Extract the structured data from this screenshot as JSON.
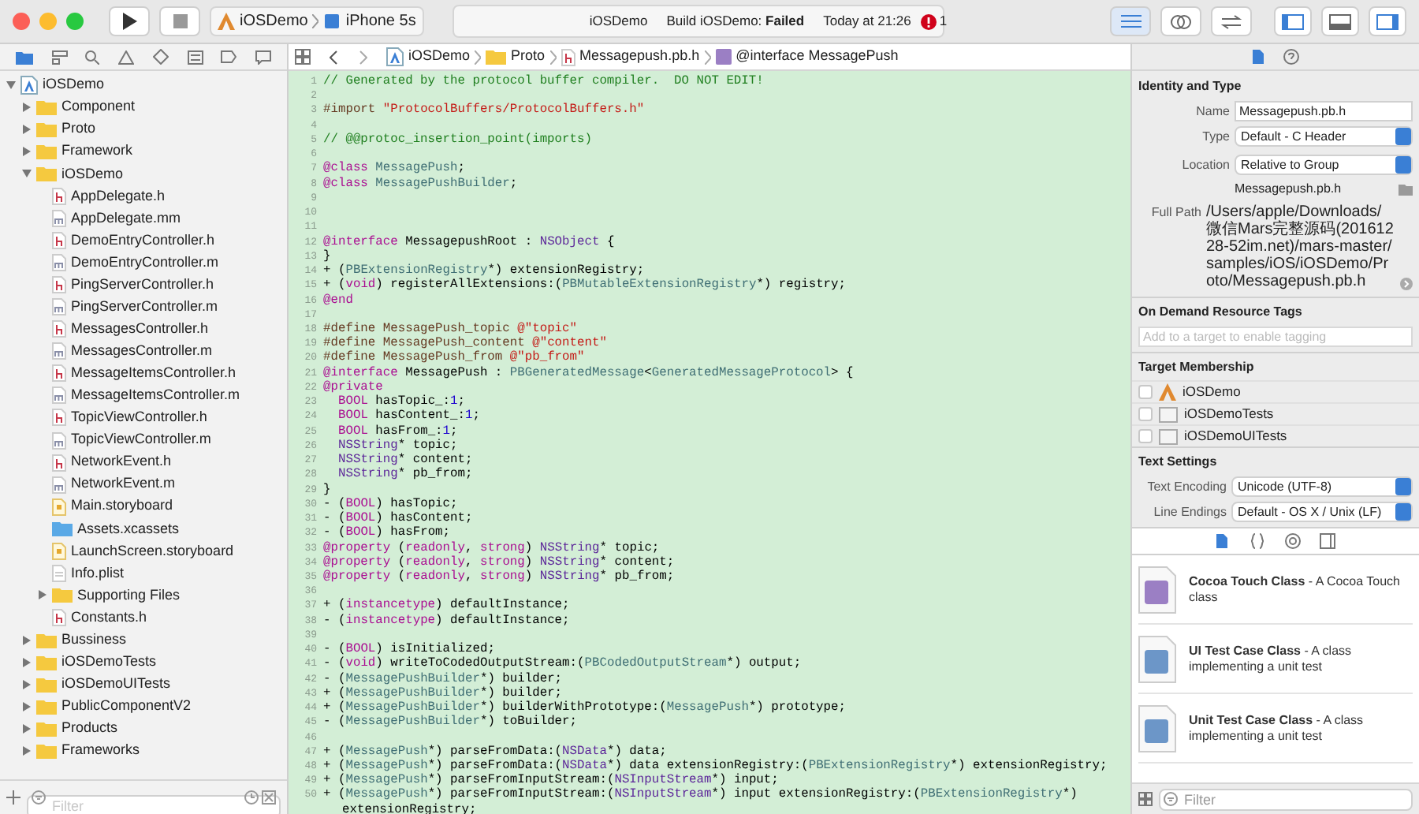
{
  "toolbar": {
    "scheme": "iOSDemo",
    "device": "iPhone 5s",
    "activity": {
      "project": "iOSDemo",
      "status": "Build iOSDemo: **Failed**",
      "time": "Today at 21:26"
    },
    "error_count": "1"
  },
  "jump_bar": [
    {
      "label": "iOSDemo",
      "kind": "project"
    },
    {
      "label": "Proto",
      "kind": "folder"
    },
    {
      "label": "Messagepush.pb.h",
      "kind": "h"
    },
    {
      "label": "@interface MessagePush",
      "kind": "class"
    }
  ],
  "navigator": {
    "tree": [
      {
        "label": "iOSDemo",
        "kind": "project",
        "expanded": true,
        "children": [
          {
            "label": "Component",
            "kind": "folder",
            "expanded": false
          },
          {
            "label": "Proto",
            "kind": "folder",
            "expanded": false
          },
          {
            "label": "Framework",
            "kind": "folder",
            "expanded": false
          },
          {
            "label": "iOSDemo",
            "kind": "folder",
            "expanded": true,
            "children": [
              {
                "label": "AppDelegate.h",
                "kind": "h"
              },
              {
                "label": "AppDelegate.mm",
                "kind": "m"
              },
              {
                "label": "DemoEntryController.h",
                "kind": "h"
              },
              {
                "label": "DemoEntryController.m",
                "kind": "m"
              },
              {
                "label": "PingServerController.h",
                "kind": "h"
              },
              {
                "label": "PingServerController.m",
                "kind": "m"
              },
              {
                "label": "MessagesController.h",
                "kind": "h"
              },
              {
                "label": "MessagesController.m",
                "kind": "m"
              },
              {
                "label": "MessageItemsController.h",
                "kind": "h"
              },
              {
                "label": "MessageItemsController.m",
                "kind": "m"
              },
              {
                "label": "TopicViewController.h",
                "kind": "h"
              },
              {
                "label": "TopicViewController.m",
                "kind": "m"
              },
              {
                "label": "NetworkEvent.h",
                "kind": "h"
              },
              {
                "label": "NetworkEvent.m",
                "kind": "m"
              },
              {
                "label": "Main.storyboard",
                "kind": "storyboard"
              },
              {
                "label": "Assets.xcassets",
                "kind": "assets"
              },
              {
                "label": "LaunchScreen.storyboard",
                "kind": "storyboard"
              },
              {
                "label": "Info.plist",
                "kind": "plist"
              },
              {
                "label": "Supporting Files",
                "kind": "folder",
                "expanded": false
              },
              {
                "label": "Constants.h",
                "kind": "h"
              }
            ]
          },
          {
            "label": "Bussiness",
            "kind": "folder",
            "expanded": false
          },
          {
            "label": "iOSDemoTests",
            "kind": "folder",
            "expanded": false
          },
          {
            "label": "iOSDemoUITests",
            "kind": "folder",
            "expanded": false
          },
          {
            "label": "PublicComponentV2",
            "kind": "folder",
            "expanded": false
          },
          {
            "label": "Products",
            "kind": "folder",
            "expanded": false
          },
          {
            "label": "Frameworks",
            "kind": "folder",
            "expanded": false
          }
        ]
      }
    ],
    "filter": {
      "placeholder": "Filter"
    }
  },
  "editor": {
    "lines": [
      {
        "n": "1",
        "tokens": [
          {
            "kind": "c",
            "text": "// Generated by the protocol buffer compiler.  DO NOT EDIT!"
          }
        ]
      },
      {
        "n": "2"
      },
      {
        "n": "3",
        "tokens": [
          {
            "kind": "p",
            "text": "#import "
          },
          {
            "kind": "s",
            "text": "\"ProtocolBuffers/ProtocolBuffers.h\""
          }
        ]
      },
      {
        "n": "4"
      },
      {
        "n": "5",
        "tokens": [
          {
            "kind": "c",
            "text": "// @@protoc_insertion_point(imports)"
          }
        ]
      },
      {
        "n": "6"
      },
      {
        "n": "7",
        "tokens": [
          {
            "kind": "k",
            "text": "@class "
          },
          {
            "kind": "t",
            "text": "MessagePush"
          },
          {
            "kind": "x",
            "text": ";"
          }
        ]
      },
      {
        "n": "8",
        "tokens": [
          {
            "kind": "k",
            "text": "@class "
          },
          {
            "kind": "t",
            "text": "MessagePushBuilder"
          },
          {
            "kind": "x",
            "text": ";"
          }
        ]
      },
      {
        "n": "9"
      },
      {
        "n": "10"
      },
      {
        "n": "11"
      },
      {
        "n": "12",
        "tokens": [
          {
            "kind": "k",
            "text": "@interface"
          },
          {
            "kind": "x",
            "text": " MessagepushRoot : "
          },
          {
            "kind": "o",
            "text": "NSObject"
          },
          {
            "kind": "x",
            "text": " {"
          }
        ]
      },
      {
        "n": "13",
        "tokens": [
          {
            "kind": "x",
            "text": "}"
          }
        ]
      },
      {
        "n": "14",
        "tokens": [
          {
            "kind": "x",
            "text": "+ ("
          },
          {
            "kind": "t",
            "text": "PBExtensionRegistry"
          },
          {
            "kind": "x",
            "text": "*) extensionRegistry;"
          }
        ]
      },
      {
        "n": "15",
        "tokens": [
          {
            "kind": "x",
            "text": "+ ("
          },
          {
            "kind": "k",
            "text": "void"
          },
          {
            "kind": "x",
            "text": ") registerAllExtensions:("
          },
          {
            "kind": "t",
            "text": "PBMutableExtensionRegistry"
          },
          {
            "kind": "x",
            "text": "*) registry;"
          }
        ]
      },
      {
        "n": "16",
        "tokens": [
          {
            "kind": "k",
            "text": "@end"
          }
        ]
      },
      {
        "n": "17"
      },
      {
        "n": "18",
        "tokens": [
          {
            "kind": "p",
            "text": "#define MessagePush_topic "
          },
          {
            "kind": "s",
            "text": "@\"topic\""
          }
        ]
      },
      {
        "n": "19",
        "tokens": [
          {
            "kind": "p",
            "text": "#define MessagePush_content "
          },
          {
            "kind": "s",
            "text": "@\"content\""
          }
        ]
      },
      {
        "n": "20",
        "tokens": [
          {
            "kind": "p",
            "text": "#define MessagePush_from "
          },
          {
            "kind": "s",
            "text": "@\"pb_from\""
          }
        ]
      },
      {
        "n": "21",
        "tokens": [
          {
            "kind": "k",
            "text": "@interface"
          },
          {
            "kind": "x",
            "text": " MessagePush : "
          },
          {
            "kind": "t",
            "text": "PBGeneratedMessage"
          },
          {
            "kind": "x",
            "text": "<"
          },
          {
            "kind": "t",
            "text": "GeneratedMessageProtocol"
          },
          {
            "kind": "x",
            "text": "> {"
          }
        ]
      },
      {
        "n": "22",
        "tokens": [
          {
            "kind": "k",
            "text": "@private"
          }
        ]
      },
      {
        "n": "23",
        "tokens": [
          {
            "kind": "k",
            "text": "  BOOL"
          },
          {
            "kind": "x",
            "text": " hasTopic_:"
          },
          {
            "kind": "n",
            "text": "1"
          },
          {
            "kind": "x",
            "text": ";"
          }
        ]
      },
      {
        "n": "24",
        "tokens": [
          {
            "kind": "k",
            "text": "  BOOL"
          },
          {
            "kind": "x",
            "text": " hasContent_:"
          },
          {
            "kind": "n",
            "text": "1"
          },
          {
            "kind": "x",
            "text": ";"
          }
        ]
      },
      {
        "n": "25",
        "tokens": [
          {
            "kind": "k",
            "text": "  BOOL"
          },
          {
            "kind": "x",
            "text": " hasFrom_:"
          },
          {
            "kind": "n",
            "text": "1"
          },
          {
            "kind": "x",
            "text": ";"
          }
        ]
      },
      {
        "n": "26",
        "tokens": [
          {
            "kind": "o",
            "text": "  NSString"
          },
          {
            "kind": "x",
            "text": "* topic;"
          }
        ]
      },
      {
        "n": "27",
        "tokens": [
          {
            "kind": "o",
            "text": "  NSString"
          },
          {
            "kind": "x",
            "text": "* content;"
          }
        ]
      },
      {
        "n": "28",
        "tokens": [
          {
            "kind": "o",
            "text": "  NSString"
          },
          {
            "kind": "x",
            "text": "* pb_from;"
          }
        ]
      },
      {
        "n": "29",
        "tokens": [
          {
            "kind": "x",
            "text": "}"
          }
        ]
      },
      {
        "n": "30",
        "tokens": [
          {
            "kind": "x",
            "text": "- ("
          },
          {
            "kind": "k",
            "text": "BOOL"
          },
          {
            "kind": "x",
            "text": ") hasTopic;"
          }
        ]
      },
      {
        "n": "31",
        "tokens": [
          {
            "kind": "x",
            "text": "- ("
          },
          {
            "kind": "k",
            "text": "BOOL"
          },
          {
            "kind": "x",
            "text": ") hasContent;"
          }
        ]
      },
      {
        "n": "32",
        "tokens": [
          {
            "kind": "x",
            "text": "- ("
          },
          {
            "kind": "k",
            "text": "BOOL"
          },
          {
            "kind": "x",
            "text": ") hasFrom;"
          }
        ]
      },
      {
        "n": "33",
        "tokens": [
          {
            "kind": "k",
            "text": "@property"
          },
          {
            "kind": "x",
            "text": " ("
          },
          {
            "kind": "k",
            "text": "readonly"
          },
          {
            "kind": "x",
            "text": ", "
          },
          {
            "kind": "k",
            "text": "strong"
          },
          {
            "kind": "x",
            "text": ") "
          },
          {
            "kind": "o",
            "text": "NSString"
          },
          {
            "kind": "x",
            "text": "* topic;"
          }
        ]
      },
      {
        "n": "34",
        "tokens": [
          {
            "kind": "k",
            "text": "@property"
          },
          {
            "kind": "x",
            "text": " ("
          },
          {
            "kind": "k",
            "text": "readonly"
          },
          {
            "kind": "x",
            "text": ", "
          },
          {
            "kind": "k",
            "text": "strong"
          },
          {
            "kind": "x",
            "text": ") "
          },
          {
            "kind": "o",
            "text": "NSString"
          },
          {
            "kind": "x",
            "text": "* content;"
          }
        ]
      },
      {
        "n": "35",
        "tokens": [
          {
            "kind": "k",
            "text": "@property"
          },
          {
            "kind": "x",
            "text": " ("
          },
          {
            "kind": "k",
            "text": "readonly"
          },
          {
            "kind": "x",
            "text": ", "
          },
          {
            "kind": "k",
            "text": "strong"
          },
          {
            "kind": "x",
            "text": ") "
          },
          {
            "kind": "o",
            "text": "NSString"
          },
          {
            "kind": "x",
            "text": "* pb_from;"
          }
        ]
      },
      {
        "n": "36"
      },
      {
        "n": "37",
        "tokens": [
          {
            "kind": "x",
            "text": "+ ("
          },
          {
            "kind": "k",
            "text": "instancetype"
          },
          {
            "kind": "x",
            "text": ") defaultInstance;"
          }
        ]
      },
      {
        "n": "38",
        "tokens": [
          {
            "kind": "x",
            "text": "- ("
          },
          {
            "kind": "k",
            "text": "instancetype"
          },
          {
            "kind": "x",
            "text": ") defaultInstance;"
          }
        ]
      },
      {
        "n": "39"
      },
      {
        "n": "40",
        "tokens": [
          {
            "kind": "x",
            "text": "- ("
          },
          {
            "kind": "k",
            "text": "BOOL"
          },
          {
            "kind": "x",
            "text": ") isInitialized;"
          }
        ]
      },
      {
        "n": "41",
        "tokens": [
          {
            "kind": "x",
            "text": "- ("
          },
          {
            "kind": "k",
            "text": "void"
          },
          {
            "kind": "x",
            "text": ") writeToCodedOutputStream:("
          },
          {
            "kind": "t",
            "text": "PBCodedOutputStream"
          },
          {
            "kind": "x",
            "text": "*) output;"
          }
        ]
      },
      {
        "n": "42",
        "tokens": [
          {
            "kind": "x",
            "text": "- ("
          },
          {
            "kind": "t",
            "text": "MessagePushBuilder"
          },
          {
            "kind": "x",
            "text": "*) builder;"
          }
        ]
      },
      {
        "n": "43",
        "tokens": [
          {
            "kind": "x",
            "text": "+ ("
          },
          {
            "kind": "t",
            "text": "MessagePushBuilder"
          },
          {
            "kind": "x",
            "text": "*) builder;"
          }
        ]
      },
      {
        "n": "44",
        "tokens": [
          {
            "kind": "x",
            "text": "+ ("
          },
          {
            "kind": "t",
            "text": "MessagePushBuilder"
          },
          {
            "kind": "x",
            "text": "*) builderWithPrototype:("
          },
          {
            "kind": "t",
            "text": "MessagePush"
          },
          {
            "kind": "x",
            "text": "*) prototype;"
          }
        ]
      },
      {
        "n": "45",
        "tokens": [
          {
            "kind": "x",
            "text": "- ("
          },
          {
            "kind": "t",
            "text": "MessagePushBuilder"
          },
          {
            "kind": "x",
            "text": "*) toBuilder;"
          }
        ]
      },
      {
        "n": "46"
      },
      {
        "n": "47",
        "tokens": [
          {
            "kind": "x",
            "text": "+ ("
          },
          {
            "kind": "t",
            "text": "MessagePush"
          },
          {
            "kind": "x",
            "text": "*) parseFromData:("
          },
          {
            "kind": "o",
            "text": "NSData"
          },
          {
            "kind": "x",
            "text": "*) data;"
          }
        ]
      },
      {
        "n": "48",
        "tokens": [
          {
            "kind": "x",
            "text": "+ ("
          },
          {
            "kind": "t",
            "text": "MessagePush"
          },
          {
            "kind": "x",
            "text": "*) parseFromData:("
          },
          {
            "kind": "o",
            "text": "NSData"
          },
          {
            "kind": "x",
            "text": "*) data extensionRegistry:("
          },
          {
            "kind": "t",
            "text": "PBExtensionRegistry"
          },
          {
            "kind": "x",
            "text": "*) extensionRegistry;"
          }
        ]
      },
      {
        "n": "49",
        "tokens": [
          {
            "kind": "x",
            "text": "+ ("
          },
          {
            "kind": "t",
            "text": "MessagePush"
          },
          {
            "kind": "x",
            "text": "*) parseFromInputStream:("
          },
          {
            "kind": "o",
            "text": "NSInputStream"
          },
          {
            "kind": "x",
            "text": "*) input;"
          }
        ]
      },
      {
        "n": "50",
        "tokens": [
          {
            "kind": "x",
            "text": "+ ("
          },
          {
            "kind": "t",
            "text": "MessagePush"
          },
          {
            "kind": "x",
            "text": "*) parseFromInputStream:("
          },
          {
            "kind": "o",
            "text": "NSInputStream"
          },
          {
            "kind": "x",
            "text": "*) input extensionRegistry:("
          },
          {
            "kind": "t",
            "text": "PBExtensionRegistry"
          },
          {
            "kind": "x",
            "text": "*) extensionRegistry;"
          }
        ]
      }
    ]
  },
  "inspector": {
    "identity": {
      "title": "Identity and Type",
      "name_label": "Name",
      "name_value": "Messagepush.pb.h",
      "type_label": "Type",
      "type_value": "Default - C Header",
      "location_label": "Location",
      "location_value": "Relative to Group",
      "file_name": "Messagepush.pb.h",
      "full_path_label": "Full Path",
      "full_path": "/Users/apple/Downloads/微信Mars完整源码(20161228-52im.net)/mars-master/samples/iOS/iOSDemo/Proto/Messagepush.pb.h"
    },
    "on_demand": {
      "title": "On Demand Resource Tags",
      "placeholder": "Add to a target to enable tagging"
    },
    "target_membership": {
      "title": "Target Membership",
      "targets": [
        {
          "label": "iOSDemo",
          "kind": "app",
          "checked": false
        },
        {
          "label": "iOSDemoTests",
          "kind": "bundle",
          "checked": false
        },
        {
          "label": "iOSDemoUITests",
          "kind": "bundle",
          "checked": false
        }
      ]
    },
    "text_settings": {
      "title": "Text Settings",
      "encoding_label": "Text Encoding",
      "encoding_value": "Unicode (UTF-8)",
      "endings_label": "Line Endings",
      "endings_value": "Default - OS X / Unix (LF)"
    },
    "library_tabs": [
      {
        "kind": "file",
        "selected": true
      },
      {
        "kind": "braces",
        "selected": false
      },
      {
        "kind": "object",
        "selected": false
      },
      {
        "kind": "media",
        "selected": false
      }
    ],
    "library": [
      {
        "text": "**Cocoa Touch Class** - A Cocoa Touch class",
        "color": "#9b7fc4"
      },
      {
        "text": "**UI Test Case Class** - A class implementing a unit test",
        "color": "#6c96c8"
      },
      {
        "text": "**Unit Test Case Class** - A class implementing a unit test",
        "color": "#6c96c8"
      }
    ],
    "filter": {
      "placeholder": "Filter"
    }
  }
}
